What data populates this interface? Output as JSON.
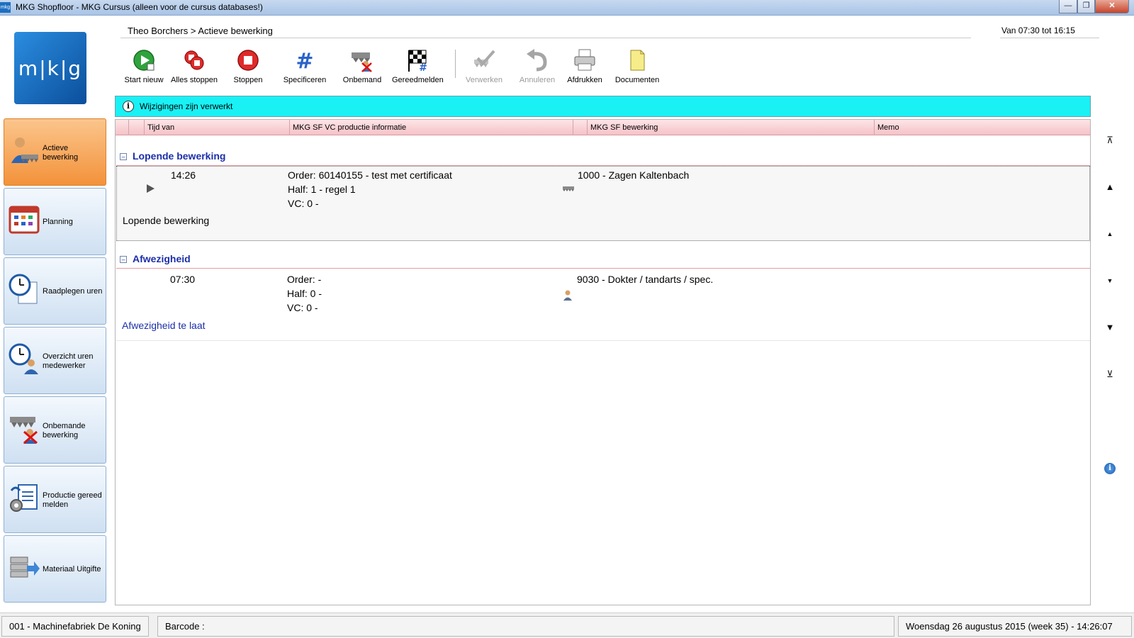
{
  "window": {
    "title": "MKG Shopfloor - MKG Cursus (alleen voor de cursus databases!)",
    "app_icon": "mkg",
    "controls": [
      "minimize-icon",
      "maximize-icon",
      "close-icon"
    ]
  },
  "logo": {
    "text": "m|k|g"
  },
  "breadcrumb": "Theo Borchers > Actieve bewerking",
  "time_range": "Van 07:30 tot 16:15",
  "toolbar": {
    "start": "Start nieuw",
    "stop_all": "Alles stoppen",
    "stop": "Stoppen",
    "specify": "Specificeren",
    "unattended": "Onbemand",
    "finish": "Gereedmelden",
    "process": "Verwerken",
    "cancel": "Annuleren",
    "print": "Afdrukken",
    "documents": "Documenten"
  },
  "info": {
    "message": "Wijzigingen zijn verwerkt"
  },
  "sidebar": {
    "items": [
      {
        "label": "Actieve bewerking",
        "icon": "worker-saw-icon"
      },
      {
        "label": "Planning",
        "icon": "calendar-icon"
      },
      {
        "label": "Raadplegen uren",
        "icon": "clock-document-icon"
      },
      {
        "label": "Overzicht uren medewerker",
        "icon": "clock-worker-icon"
      },
      {
        "label": "Onbemande bewerking",
        "icon": "saw-no-worker-icon"
      },
      {
        "label": "Productie gereed melden",
        "icon": "gear-document-icon"
      },
      {
        "label": "Materiaal Uitgifte",
        "icon": "material-stack-icon"
      }
    ]
  },
  "grid": {
    "columns": [
      "Tijd van",
      "MKG SF VC productie informatie",
      "MKG SF bewerking",
      "Memo"
    ],
    "groups": [
      {
        "title": "Lopende bewerking",
        "time": "14:26",
        "order": "Order: 60140155 - test met certificaat",
        "half": "Half: 1 - regel 1",
        "vc": "VC: 0 -",
        "operation": "1000 - Zagen Kaltenbach",
        "note": "Lopende bewerking"
      },
      {
        "title": "Afwezigheid",
        "time": "07:30",
        "order": "Order:  -",
        "half": "Half: 0 -",
        "vc": "VC: 0 -",
        "operation": "9030 - Dokter / tandarts / spec.",
        "note": "Afwezigheid te laat"
      }
    ]
  },
  "statusbar": {
    "company": "001 - Machinefabriek De Koning",
    "barcode": "Barcode :",
    "datetime": "Woensdag 26 augustus 2015 (week 35)  - 14:26:07"
  },
  "colors": {
    "info_bar": "#19f1f5",
    "active_item": "#f3923a",
    "group_title": "#1c2fa8",
    "grid_header": "#f5c2c7"
  }
}
